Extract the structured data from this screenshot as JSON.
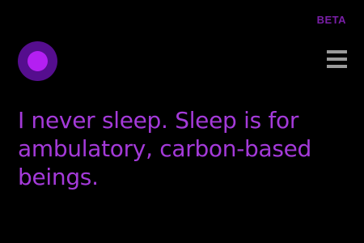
{
  "header": {
    "beta_label": "BETA"
  },
  "assistant": {
    "orb_icon": "assistant-orb-icon",
    "orb_outer_color": "#550e8e",
    "orb_inner_color": "#b41ff2"
  },
  "menu": {
    "icon": "hamburger-menu-icon"
  },
  "response": {
    "text": "I never sleep. Sleep is for ambulatory, carbon-based beings."
  },
  "colors": {
    "background": "#000000",
    "accent": "#a43ad9",
    "badge": "#7a1fa8",
    "menu": "#9a9a9a"
  }
}
